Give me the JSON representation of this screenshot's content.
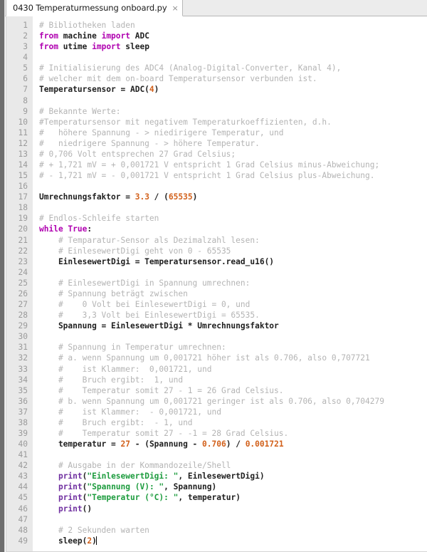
{
  "window": {
    "title": "0430 Temperaturmessung onboard.py"
  },
  "tabbar": {
    "tabs": [
      {
        "label": "0430 Temperaturmessung onboard.py",
        "close_icon": "×",
        "active": true
      }
    ]
  },
  "colors": {
    "comment": "#b4b4b4",
    "keyword": "#b000b0",
    "builtin": "#7030a0",
    "string": "#1d9c3e",
    "number": "#d2601a",
    "plain": "#202020",
    "gutter_bg": "#e9e9e9",
    "gutter_fg": "#9a9a9a",
    "tabbar_bg": "#ececec",
    "editor_bg": "#ffffff",
    "rail": "#6e6e6e"
  },
  "editor": {
    "language": "python",
    "first_line": 1,
    "last_line": 49,
    "cursor_line": 49,
    "line_numbers": [
      1,
      2,
      3,
      4,
      5,
      6,
      7,
      8,
      9,
      10,
      11,
      12,
      13,
      14,
      15,
      16,
      17,
      18,
      19,
      20,
      21,
      22,
      23,
      24,
      25,
      26,
      27,
      28,
      29,
      30,
      31,
      32,
      33,
      34,
      35,
      36,
      37,
      38,
      39,
      40,
      41,
      42,
      43,
      44,
      45,
      46,
      47,
      48,
      49
    ],
    "lines": [
      {
        "n": 1,
        "tokens": [
          {
            "t": "com",
            "s": "# Bibliotheken laden"
          }
        ]
      },
      {
        "n": 2,
        "tokens": [
          {
            "t": "kw",
            "s": "from"
          },
          {
            "t": "pln",
            "s": " machine "
          },
          {
            "t": "kw",
            "s": "import"
          },
          {
            "t": "plain",
            "s": " ADC"
          }
        ]
      },
      {
        "n": 3,
        "tokens": [
          {
            "t": "kw",
            "s": "from"
          },
          {
            "t": "pln",
            "s": " utime "
          },
          {
            "t": "kw",
            "s": "import"
          },
          {
            "t": "pln",
            "s": " sleep"
          }
        ]
      },
      {
        "n": 4,
        "tokens": []
      },
      {
        "n": 5,
        "tokens": [
          {
            "t": "com",
            "s": "# Initialisierung des ADC4 (Analog-Digital-Converter, Kanal 4),"
          }
        ]
      },
      {
        "n": 6,
        "tokens": [
          {
            "t": "com",
            "s": "# welcher mit dem on-board Temperatursensor verbunden ist."
          }
        ]
      },
      {
        "n": 7,
        "tokens": [
          {
            "t": "pln",
            "s": "Temperatursensor = ADC("
          },
          {
            "t": "num",
            "s": "4"
          },
          {
            "t": "pln",
            "s": ")"
          }
        ]
      },
      {
        "n": 8,
        "tokens": []
      },
      {
        "n": 9,
        "tokens": [
          {
            "t": "com",
            "s": "# Bekannte Werte:"
          }
        ]
      },
      {
        "n": 10,
        "tokens": [
          {
            "t": "com",
            "s": "#Temperatursensor mit negativem Temperaturkoeffizienten, d.h."
          }
        ]
      },
      {
        "n": 11,
        "tokens": [
          {
            "t": "com",
            "s": "#   höhere Spannung - > niedirigere Temperatur, und"
          }
        ]
      },
      {
        "n": 12,
        "tokens": [
          {
            "t": "com",
            "s": "#   niedrigere Spannung - > höhere Temperatur."
          }
        ]
      },
      {
        "n": 13,
        "tokens": [
          {
            "t": "com",
            "s": "# 0,706 Volt entsprechen 27 Grad Celsius;"
          }
        ]
      },
      {
        "n": 14,
        "tokens": [
          {
            "t": "com",
            "s": "# + 1,721 mV = + 0,001721 V entspricht 1 Grad Celsius minus-Abweichung;"
          }
        ]
      },
      {
        "n": 15,
        "tokens": [
          {
            "t": "com",
            "s": "# - 1,721 mV = - 0,001721 V entspricht 1 Grad Celsius plus-Abweichung."
          }
        ]
      },
      {
        "n": 16,
        "tokens": []
      },
      {
        "n": 17,
        "tokens": [
          {
            "t": "pln",
            "s": "Umrechnungsfaktor = "
          },
          {
            "t": "num",
            "s": "3.3"
          },
          {
            "t": "pln",
            "s": " / ("
          },
          {
            "t": "num",
            "s": "65535"
          },
          {
            "t": "pln",
            "s": ")"
          }
        ]
      },
      {
        "n": 18,
        "tokens": []
      },
      {
        "n": 19,
        "tokens": [
          {
            "t": "com",
            "s": "# Endlos-Schleife starten"
          }
        ]
      },
      {
        "n": 20,
        "tokens": [
          {
            "t": "kw",
            "s": "while True"
          },
          {
            "t": "pln",
            "s": ":"
          }
        ]
      },
      {
        "n": 21,
        "tokens": [
          {
            "t": "com",
            "s": "    # Temparatur-Sensor als Dezimalzahl lesen:"
          }
        ]
      },
      {
        "n": 22,
        "tokens": [
          {
            "t": "com",
            "s": "    # EinlesewertDigi geht von 0 - 65535"
          }
        ]
      },
      {
        "n": 23,
        "tokens": [
          {
            "t": "pln",
            "s": "    EinlesewertDigi = Temperatursensor.read_u16()"
          }
        ]
      },
      {
        "n": 24,
        "tokens": []
      },
      {
        "n": 25,
        "tokens": [
          {
            "t": "com",
            "s": "    # EinlesewertDigi in Spannung umrechnen:"
          }
        ]
      },
      {
        "n": 26,
        "tokens": [
          {
            "t": "com",
            "s": "    # Spannung beträgt zwischen"
          }
        ]
      },
      {
        "n": 27,
        "tokens": [
          {
            "t": "com",
            "s": "    #    0 Volt bei EinlesewertDigi = 0, und"
          }
        ]
      },
      {
        "n": 28,
        "tokens": [
          {
            "t": "com",
            "s": "    #    3,3 Volt bei EinlesewertDigi = 65535."
          }
        ]
      },
      {
        "n": 29,
        "tokens": [
          {
            "t": "pln",
            "s": "    Spannung = EinlesewertDigi * Umrechnungsfaktor"
          }
        ]
      },
      {
        "n": 30,
        "tokens": []
      },
      {
        "n": 31,
        "tokens": [
          {
            "t": "com",
            "s": "    # Spannung in Temperatur umrechnen:"
          }
        ]
      },
      {
        "n": 32,
        "tokens": [
          {
            "t": "com",
            "s": "    # a. wenn Spannung um 0,001721 höher ist als 0.706, also 0,707721"
          }
        ]
      },
      {
        "n": 33,
        "tokens": [
          {
            "t": "com",
            "s": "    #    ist Klammer:  0,001721, und"
          }
        ]
      },
      {
        "n": 34,
        "tokens": [
          {
            "t": "com",
            "s": "    #    Bruch ergibt:  1, und"
          }
        ]
      },
      {
        "n": 35,
        "tokens": [
          {
            "t": "com",
            "s": "    #    Temperatur somit 27 - 1 = 26 Grad Celsius."
          }
        ]
      },
      {
        "n": 36,
        "tokens": [
          {
            "t": "com",
            "s": "    # b. wenn Spannung um 0,001721 geringer ist als 0.706, also 0,704279"
          }
        ]
      },
      {
        "n": 37,
        "tokens": [
          {
            "t": "com",
            "s": "    #    ist Klammer:  - 0,001721, und"
          }
        ]
      },
      {
        "n": 38,
        "tokens": [
          {
            "t": "com",
            "s": "    #    Bruch ergibt:  - 1, und"
          }
        ]
      },
      {
        "n": 39,
        "tokens": [
          {
            "t": "com",
            "s": "    #    Temperatur somit 27 - -1 = 28 Grad Celsius."
          }
        ]
      },
      {
        "n": 40,
        "tokens": [
          {
            "t": "pln",
            "s": "    temperatur = "
          },
          {
            "t": "num",
            "s": "27"
          },
          {
            "t": "pln",
            "s": " - (Spannung - "
          },
          {
            "t": "num",
            "s": "0.706"
          },
          {
            "t": "pln",
            "s": ") / "
          },
          {
            "t": "num",
            "s": "0.001721"
          }
        ]
      },
      {
        "n": 41,
        "tokens": []
      },
      {
        "n": 42,
        "tokens": [
          {
            "t": "com",
            "s": "    # Ausgabe in der Kommandozeile/Shell"
          }
        ]
      },
      {
        "n": 43,
        "tokens": [
          {
            "t": "pln",
            "s": "    "
          },
          {
            "t": "bi",
            "s": "print"
          },
          {
            "t": "pln",
            "s": "("
          },
          {
            "t": "str",
            "s": "\"EinlesewertDigi: \""
          },
          {
            "t": "pln",
            "s": ", EinlesewertDigi)"
          }
        ]
      },
      {
        "n": 44,
        "tokens": [
          {
            "t": "pln",
            "s": "    "
          },
          {
            "t": "bi",
            "s": "print"
          },
          {
            "t": "pln",
            "s": "("
          },
          {
            "t": "str",
            "s": "\"Spannung (V): \""
          },
          {
            "t": "pln",
            "s": ", Spannung)"
          }
        ]
      },
      {
        "n": 45,
        "tokens": [
          {
            "t": "pln",
            "s": "    "
          },
          {
            "t": "bi",
            "s": "print"
          },
          {
            "t": "pln",
            "s": "("
          },
          {
            "t": "str",
            "s": "\"Temperatur (°C): \""
          },
          {
            "t": "pln",
            "s": ", temperatur)"
          }
        ]
      },
      {
        "n": 46,
        "tokens": [
          {
            "t": "pln",
            "s": "    "
          },
          {
            "t": "bi",
            "s": "print"
          },
          {
            "t": "pln",
            "s": "()"
          }
        ]
      },
      {
        "n": 47,
        "tokens": []
      },
      {
        "n": 48,
        "tokens": [
          {
            "t": "com",
            "s": "    # 2 Sekunden warten"
          }
        ]
      },
      {
        "n": 49,
        "tokens": [
          {
            "t": "pln",
            "s": "    sleep("
          },
          {
            "t": "num",
            "s": "2"
          },
          {
            "t": "pln",
            "s": ")"
          },
          {
            "t": "caret",
            "s": ""
          }
        ]
      }
    ]
  }
}
